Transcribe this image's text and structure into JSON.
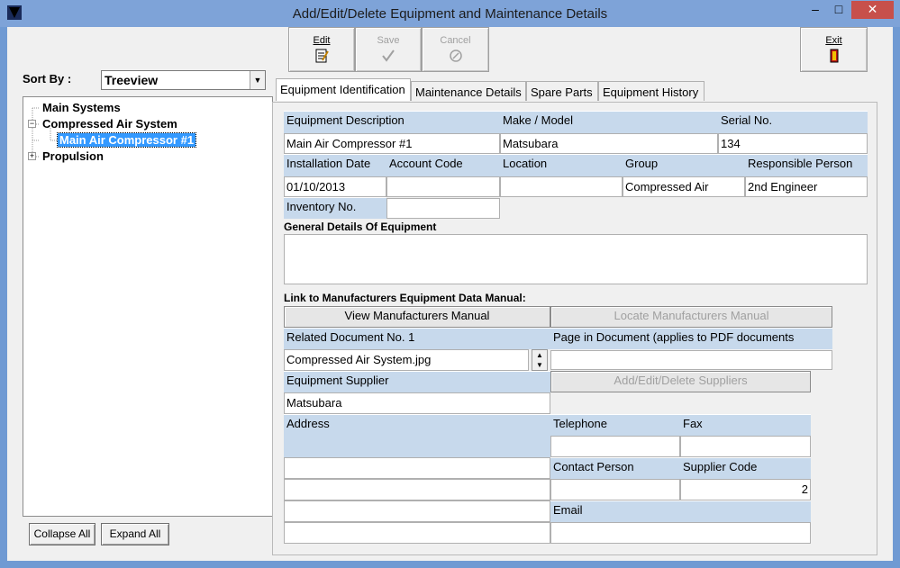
{
  "window": {
    "title": "Add/Edit/Delete Equipment and Maintenance Details",
    "minimize_glyph": "–",
    "maximize_glyph": "□",
    "close_glyph": "✕"
  },
  "toolbar": {
    "edit_label": "Edit",
    "save_label": "Save",
    "cancel_label": "Cancel",
    "exit_label": "Exit"
  },
  "sort": {
    "label": "Sort By :",
    "value": "Treeview"
  },
  "tree": {
    "items": [
      {
        "label": "Main Systems"
      },
      {
        "label": "Compressed Air System"
      },
      {
        "label": "Main Air Compressor #1"
      },
      {
        "label": "Propulsion"
      }
    ]
  },
  "tree_buttons": {
    "collapse": "Collapse All",
    "expand": "Expand All"
  },
  "tabs": [
    {
      "label": "Equipment Identification"
    },
    {
      "label": "Maintenance Details"
    },
    {
      "label": "Spare Parts"
    },
    {
      "label": "Equipment History"
    }
  ],
  "equipment": {
    "desc_label": "Equipment Description",
    "desc_value": "Main Air Compressor #1",
    "make_label": "Make / Model",
    "make_value": "Matsubara",
    "serial_label": "Serial No.",
    "serial_value": "134",
    "install_label": "Installation Date",
    "install_value": "01/10/2013",
    "account_label": "Account Code",
    "account_value": "",
    "location_label": "Location",
    "location_value": "",
    "group_label": "Group",
    "group_value": "Compressed Air",
    "responsible_label": "Responsible Person",
    "responsible_value": "2nd Engineer",
    "inventory_label": "Inventory No.",
    "inventory_value": "",
    "general_label": "General Details Of Equipment",
    "general_value": ""
  },
  "manual": {
    "section_label": "Link to Manufacturers Equipment Data Manual:",
    "view_button": "View Manufacturers Manual",
    "locate_button": "Locate Manufacturers Manual",
    "related_label": "Related Document No. 1",
    "related_value": "Compressed Air System.jpg",
    "page_label": "Page in Document (applies to PDF documents",
    "page_value": ""
  },
  "supplier": {
    "label": "Equipment Supplier",
    "value": "Matsubara",
    "add_button": "Add/Edit/Delete Suppliers",
    "address_label": "Address",
    "telephone_label": "Telephone",
    "fax_label": "Fax",
    "contact_label": "Contact Person",
    "code_label": "Supplier Code",
    "code_value": "2",
    "email_label": "Email"
  }
}
